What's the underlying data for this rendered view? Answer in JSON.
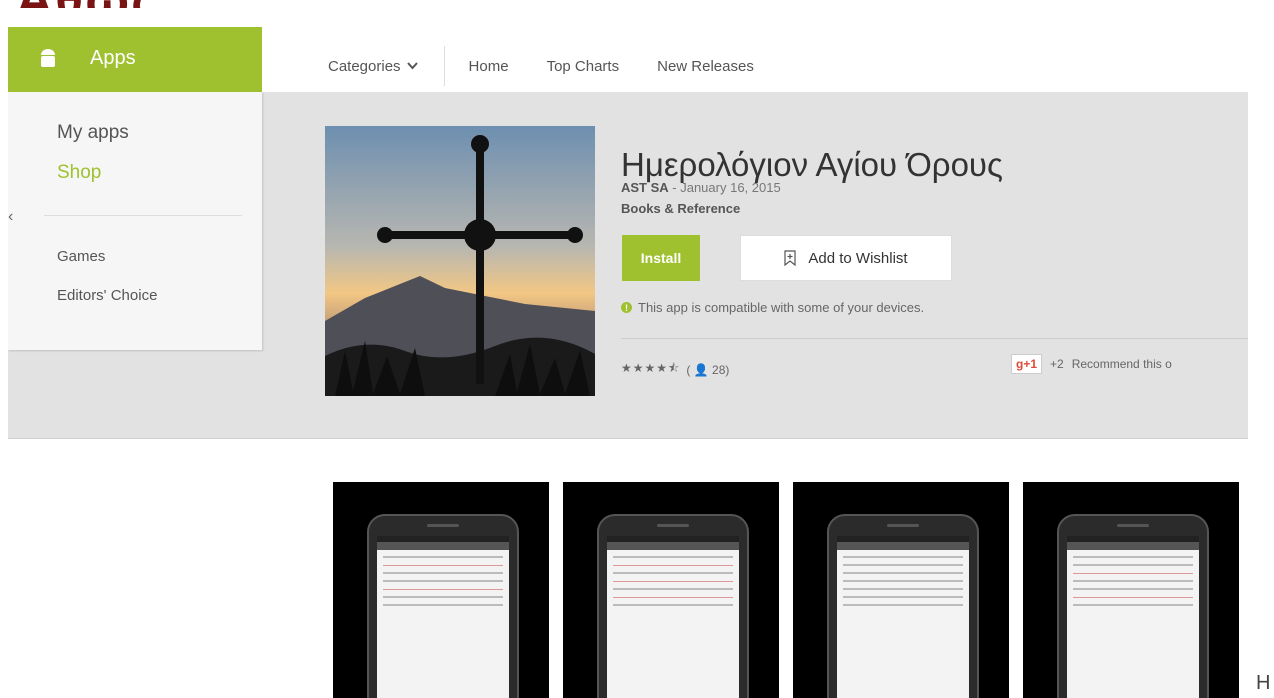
{
  "header": {
    "apps_label": "Apps",
    "nav": {
      "categories": "Categories",
      "links": [
        "Home",
        "Top Charts",
        "New Releases"
      ]
    }
  },
  "sidebar": {
    "my_apps": "My apps",
    "shop": "Shop",
    "games": "Games",
    "editors_choice": "Editors' Choice"
  },
  "app": {
    "title": "Ημερολόγιον Αγίου Όρους",
    "developer": "AST SA",
    "date": " - January 16, 2015",
    "category": "Books & Reference",
    "install_label": "Install",
    "wishlist_label": "Add to Wishlist",
    "compat_text": "This app is compatible with some of your devices.",
    "rating_count": "28",
    "gplus_label": "g+1",
    "gplus_count": "+2",
    "recommend_text": "Recommend this o"
  },
  "footer_letter": "H",
  "colors": {
    "accent": "#9fc12f",
    "band": "#e2e2e2",
    "crop_text": "#7a1414"
  },
  "icons": [
    "android-icon",
    "chevron-down-icon",
    "bookmark-plus-icon",
    "info-icon",
    "person-icon",
    "left-arrow-icon"
  ]
}
